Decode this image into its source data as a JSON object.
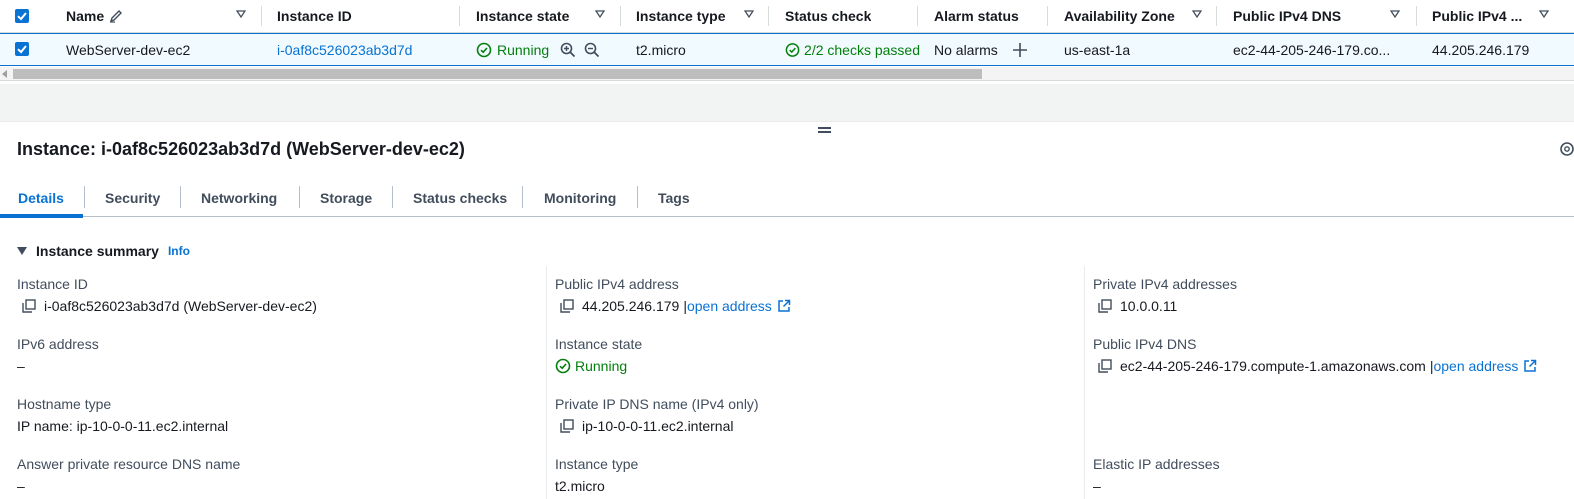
{
  "table": {
    "columns": [
      {
        "label": "Name"
      },
      {
        "label": "Instance ID"
      },
      {
        "label": "Instance state"
      },
      {
        "label": "Instance type"
      },
      {
        "label": "Status check"
      },
      {
        "label": "Alarm status"
      },
      {
        "label": "Availability Zone"
      },
      {
        "label": "Public IPv4 DNS"
      },
      {
        "label": "Public IPv4 ..."
      }
    ],
    "row": {
      "name": "WebServer-dev-ec2",
      "instance_id": "i-0af8c526023ab3d7d",
      "state": "Running",
      "type": "t2.micro",
      "status_check": "2/2 checks passed",
      "alarm": "No alarms",
      "az": "us-east-1a",
      "dns": "ec2-44-205-246-179.co...",
      "ipv4": "44.205.246.179"
    }
  },
  "details": {
    "title": "Instance: i-0af8c526023ab3d7d (WebServer-dev-ec2)",
    "tabs": [
      "Details",
      "Security",
      "Networking",
      "Storage",
      "Status checks",
      "Monitoring",
      "Tags"
    ],
    "summary_title": "Instance summary",
    "info_label": "Info",
    "open_address": "open address",
    "fields": {
      "instance_id": {
        "label": "Instance ID",
        "value": "i-0af8c526023ab3d7d (WebServer-dev-ec2)"
      },
      "ipv6": {
        "label": "IPv6 address",
        "value": "–"
      },
      "hostname_type": {
        "label": "Hostname type",
        "value": "IP name: ip-10-0-0-11.ec2.internal"
      },
      "answer_dns": {
        "label": "Answer private resource DNS name",
        "value": "–"
      },
      "public_ipv4": {
        "label": "Public IPv4 address",
        "value": "44.205.246.179",
        "separator": "|"
      },
      "instance_state": {
        "label": "Instance state",
        "value": "Running"
      },
      "private_dns": {
        "label": "Private IP DNS name (IPv4 only)",
        "value": "ip-10-0-0-11.ec2.internal"
      },
      "instance_type": {
        "label": "Instance type",
        "value": "t2.micro"
      },
      "private_ipv4": {
        "label": "Private IPv4 addresses",
        "value": "10.0.0.11"
      },
      "public_dns": {
        "label": "Public IPv4 DNS",
        "value": "ec2-44-205-246-179.compute-1.amazonaws.com",
        "separator": "|"
      },
      "elastic_ip": {
        "label": "Elastic IP addresses",
        "value": "–"
      }
    }
  },
  "colors": {
    "accent": "#0972d3",
    "success": "#037f0c",
    "text": "#16191f",
    "muted": "#414d5c"
  }
}
